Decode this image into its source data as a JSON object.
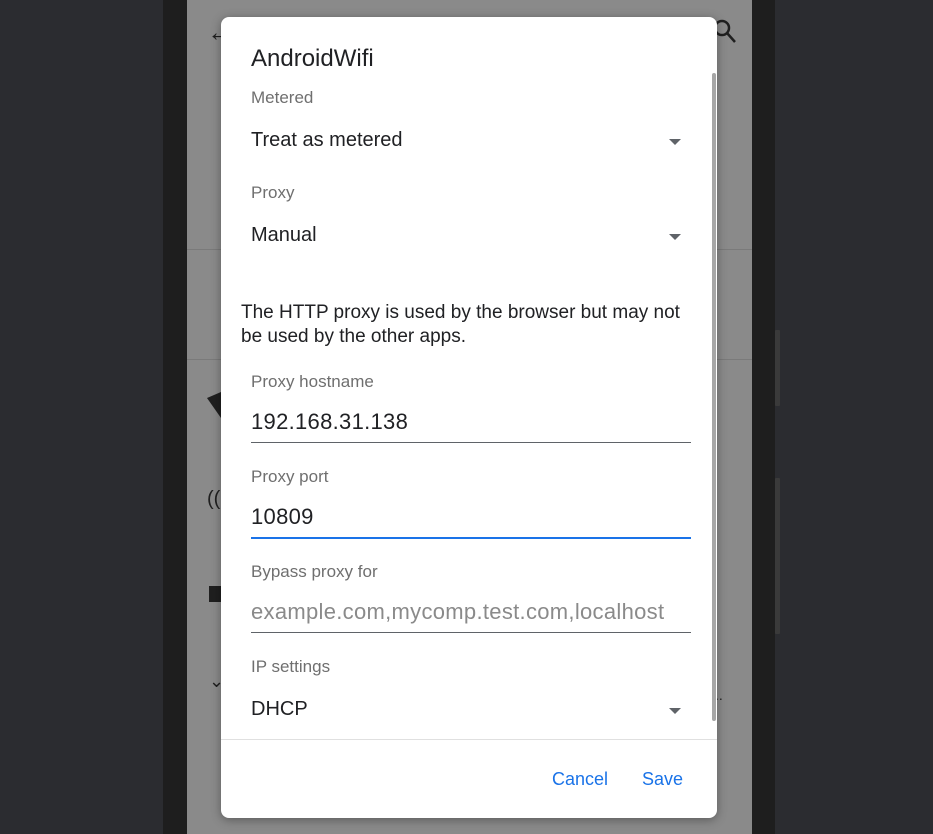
{
  "dialog": {
    "title": "AndroidWifi",
    "metered": {
      "label": "Metered",
      "value": "Treat as metered"
    },
    "proxy": {
      "label": "Proxy",
      "value": "Manual"
    },
    "info_text": "The HTTP proxy is used by the browser but may not be used by the other apps.",
    "proxy_hostname": {
      "label": "Proxy hostname",
      "value": "192.168.31.138"
    },
    "proxy_port": {
      "label": "Proxy port",
      "value": "10809"
    },
    "bypass": {
      "label": "Bypass proxy for",
      "placeholder": "example.com,mycomp.test.com,localhost"
    },
    "ip_settings": {
      "label": "IP settings",
      "value": "DHCP"
    },
    "cancel_label": "Cancel",
    "save_label": "Save"
  },
  "colors": {
    "accent": "#1a73e8",
    "scrim": "#8a8a8a"
  }
}
